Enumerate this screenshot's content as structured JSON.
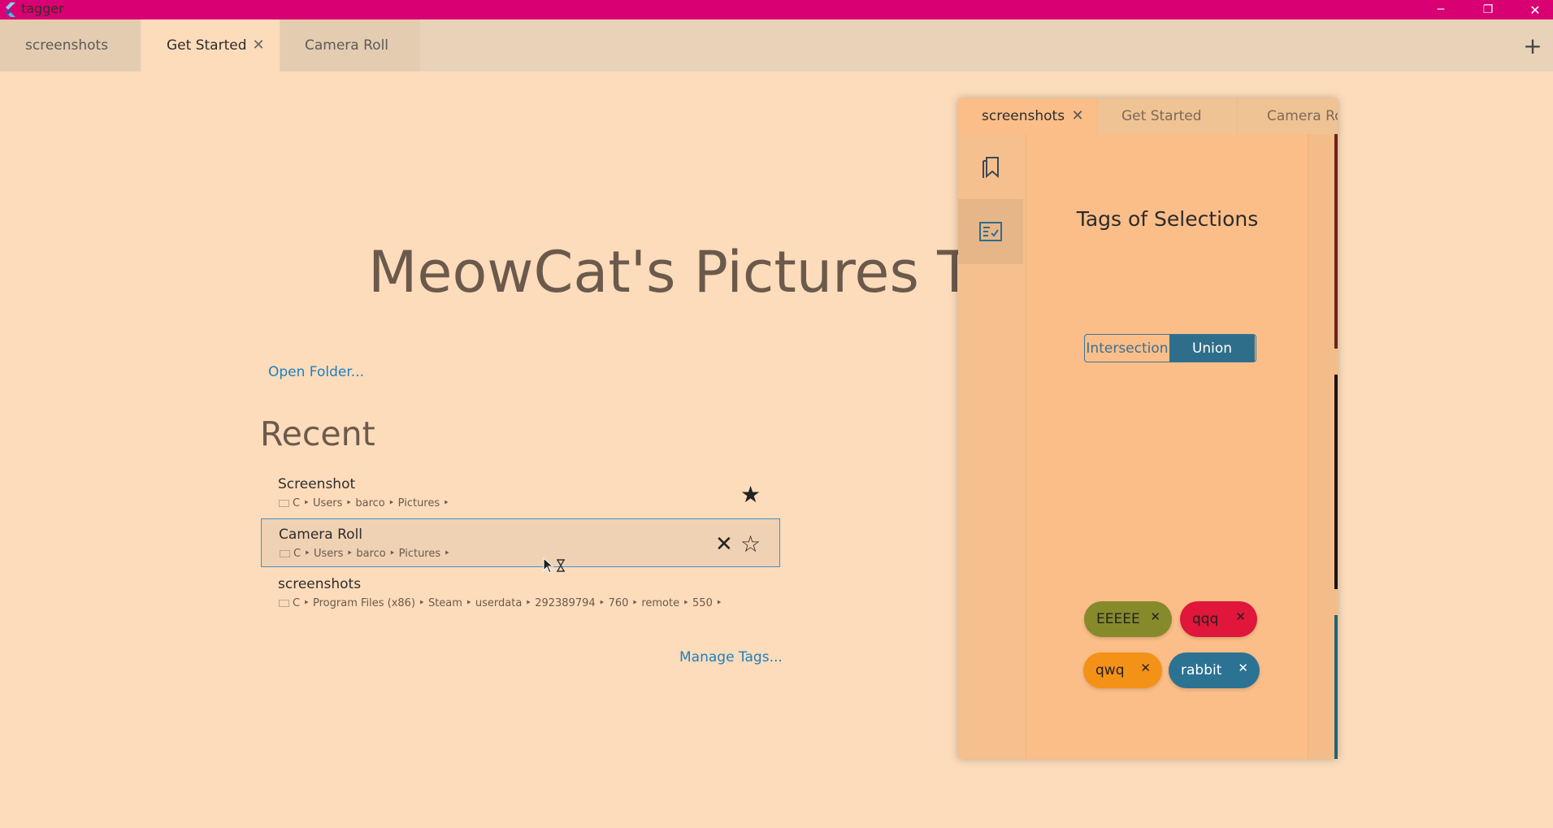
{
  "window": {
    "title": "tagger",
    "accent": "#d80073",
    "minimize_glyph": "─",
    "maximize_glyph": "❐",
    "close_glyph": "✕"
  },
  "tabs": [
    {
      "label": "screenshots"
    },
    {
      "label": "Get Started",
      "active": true
    },
    {
      "label": "Camera Roll"
    }
  ],
  "tab_close_glyph": "✕",
  "tab_add_glyph": "+",
  "main": {
    "heading": "MeowCat's Pictures Tag",
    "open_folder": "Open Folder...",
    "recent_title": "Recent",
    "recent": [
      {
        "name": "Screenshot",
        "path": "C ‣ Users ‣ barco ‣ Pictures ‣",
        "pinned": true
      },
      {
        "name": "Camera Roll",
        "path": "C ‣ Users ‣ barco ‣ Pictures ‣",
        "pinned": false,
        "hovered": true
      },
      {
        "name": "screenshots",
        "path": "C ‣ Program Files (x86) ‣ Steam ‣ userdata ‣ 292389794 ‣ 760 ‣ remote ‣ 550 ‣",
        "pinned": false
      }
    ],
    "star_filled_glyph": "★",
    "star_outline_glyph": "☆",
    "remove_glyph": "✕",
    "manage_tags": "Manage Tags..."
  },
  "panel": {
    "tabs": [
      {
        "label": "screenshots",
        "active": true
      },
      {
        "label": "Get Started"
      },
      {
        "label": "Camera Roll"
      }
    ],
    "rail": [
      {
        "icon": "bookmarks-icon"
      },
      {
        "icon": "checklist-icon",
        "selected": true
      }
    ],
    "title": "Tags of Selections",
    "mode_options": [
      "Intersection",
      "Union"
    ],
    "mode_selected": "Union",
    "chip_remove_glyph": "✕",
    "tags": [
      {
        "name": "EEEEE",
        "color": "#878a2a"
      },
      {
        "name": "qqq",
        "color": "#e0163a"
      },
      {
        "name": "qwq",
        "color": "#f49117"
      },
      {
        "name": "rabbit",
        "color": "#2b7293"
      }
    ]
  },
  "colors": {
    "background": "#fcdcbb",
    "panel": "#fbbe88",
    "link": "#1e7fbf",
    "toggle_selected": "#2f6e8a"
  }
}
